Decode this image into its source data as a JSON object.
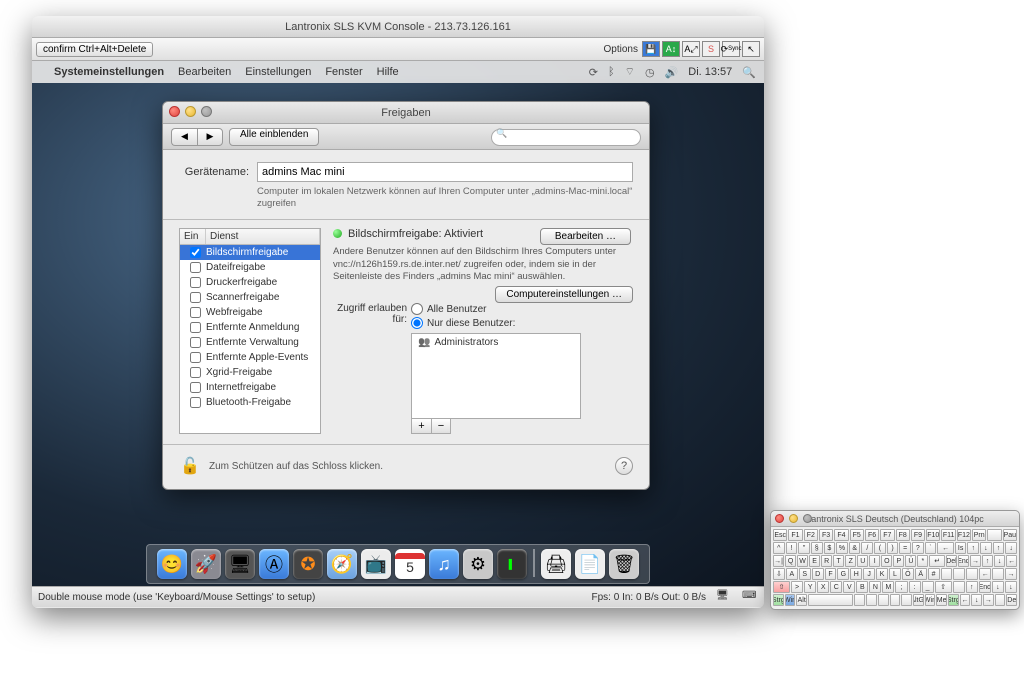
{
  "kvm": {
    "title": "Lantronix SLS KVM Console - 213.73.126.161",
    "confirm_button": "confirm Ctrl+Alt+Delete",
    "options_label": "Options",
    "toolbar_icons": [
      "save-icon",
      "device-icon",
      "text-icon",
      "sync-icon",
      "resync-icon",
      "cursor-icon"
    ],
    "status_left": "Double mouse mode (use 'Keyboard/Mouse Settings' to setup)",
    "status_right": "Fps: 0 In: 0 B/s Out: 0 B/s"
  },
  "mac_menu": {
    "app": "Systemeinstellungen",
    "items": [
      "Bearbeiten",
      "Einstellungen",
      "Fenster",
      "Hilfe"
    ],
    "clock": "Di. 13:57"
  },
  "prefs": {
    "title": "Freigaben",
    "show_all": "Alle einblenden",
    "search_placeholder": "",
    "devname_label": "Gerätename:",
    "devname_value": "admins Mac mini",
    "devname_note": "Computer im lokalen Netzwerk können auf Ihren Computer unter „admins-Mac-mini.local“ zugreifen",
    "edit_button": "Bearbeiten …",
    "col_ein": "Ein",
    "col_dienst": "Dienst",
    "services": [
      {
        "on": true,
        "name": "Bildschirmfreigabe",
        "sel": true
      },
      {
        "on": false,
        "name": "Dateifreigabe"
      },
      {
        "on": false,
        "name": "Druckerfreigabe"
      },
      {
        "on": false,
        "name": "Scannerfreigabe"
      },
      {
        "on": false,
        "name": "Webfreigabe"
      },
      {
        "on": false,
        "name": "Entfernte Anmeldung"
      },
      {
        "on": false,
        "name": "Entfernte Verwaltung"
      },
      {
        "on": false,
        "name": "Entfernte Apple-Events"
      },
      {
        "on": false,
        "name": "Xgrid-Freigabe"
      },
      {
        "on": false,
        "name": "Internetfreigabe"
      },
      {
        "on": false,
        "name": "Bluetooth-Freigabe"
      }
    ],
    "status_title": "Bildschirmfreigabe: Aktiviert",
    "detail_note": "Andere Benutzer können auf den Bildschirm Ihres Computers unter vnc://n126h159.rs.de.inter.net/ zugreifen oder, indem sie in der Seitenleiste des Finders „admins Mac mini“ auswählen.",
    "computer_settings": "Computereinstellungen …",
    "access_label": "Zugriff erlauben für:",
    "radio_all": "Alle Benutzer",
    "radio_these": "Nur diese Benutzer:",
    "users": [
      "Administrators"
    ],
    "add": "+",
    "remove": "−",
    "lock_text": "Zum Schützen auf das Schloss klicken.",
    "help": "?"
  },
  "dock": {
    "items": [
      "finder",
      "launchpad",
      "mission",
      "appstore",
      "dashboard",
      "safari",
      "itv",
      "calendar",
      "itunes",
      "settings",
      "terminal",
      "printers",
      "trash"
    ]
  },
  "vkbd": {
    "title": "Lantronix SLS Deutsch (Deutschland) 104pc",
    "rows": [
      [
        "Esc",
        "F1",
        "F2",
        "F3",
        "F4",
        "F5",
        "F6",
        "F7",
        "F8",
        "F9",
        "F10",
        "F11",
        "F12",
        "Prn",
        " ",
        "Pau"
      ],
      [
        "^",
        "!",
        "\"",
        "§",
        "$",
        "%",
        "&",
        "/",
        "(",
        ")",
        "=",
        "?",
        "`",
        "←",
        "Is",
        "↑",
        "↓",
        "↑",
        "↓"
      ],
      [
        "→|",
        "Q",
        "W",
        "E",
        "R",
        "T",
        "Z",
        "U",
        "I",
        "O",
        "P",
        "Ü",
        "*",
        "↵",
        "Del",
        "End",
        "→",
        "↑",
        "↓",
        "←"
      ],
      [
        "⇩",
        "A",
        "S",
        "D",
        "F",
        "G",
        "H",
        "J",
        "K",
        "L",
        "Ö",
        "Ä",
        "#",
        "",
        "",
        "",
        "←",
        "",
        "→"
      ],
      [
        "⇧",
        ">",
        "Y",
        "X",
        "C",
        "V",
        "B",
        "N",
        "M",
        ";",
        ":",
        "_",
        "⇧",
        "",
        "↑",
        "End",
        "↓",
        "↓"
      ],
      [
        "Strg",
        "Win",
        "Alt",
        "",
        "",
        "",
        "",
        "",
        "",
        "AltGr",
        "Win",
        "Me",
        "Strg",
        "←",
        "↓",
        "→",
        "",
        "De"
      ]
    ]
  }
}
